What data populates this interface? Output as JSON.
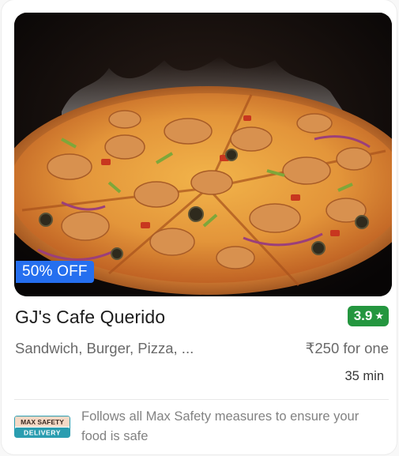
{
  "card": {
    "discount": "50% OFF",
    "name": "GJ's Cafe Querido",
    "rating": "3.9",
    "rating_icon": "star-icon",
    "cuisines": "Sandwich, Burger, Pizza, ...",
    "price": "₹250 for one",
    "delivery_time": "35 min",
    "safety": {
      "badge_line1": "MAX SAFETY",
      "badge_line2": "DELIVERY",
      "text": "Follows all Max Safety measures to ensure your food is safe"
    }
  },
  "colors": {
    "discount_badge": "#256FEF",
    "rating_badge": "#24963F",
    "title": "#1C1C1C",
    "secondary_text": "#696969"
  }
}
